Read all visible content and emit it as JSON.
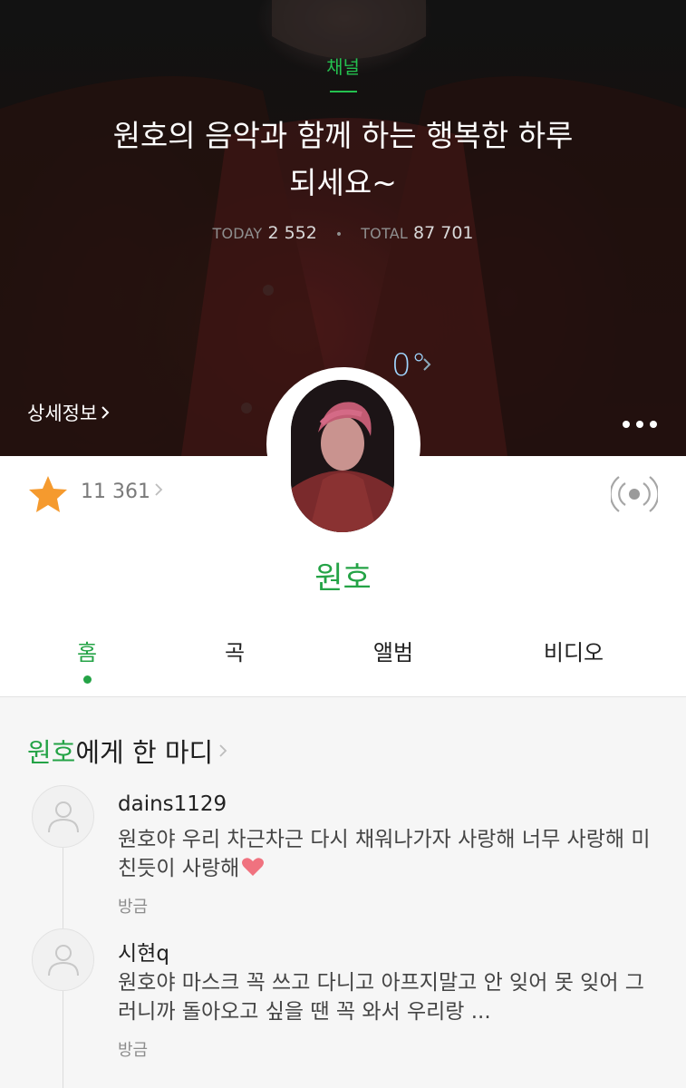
{
  "hero": {
    "channel_label": "채널",
    "title": "원호의 음악과 함께 하는 행복한 하루 되세요~",
    "today_label": "TODAY",
    "today_value": "2 552",
    "total_label": "TOTAL",
    "total_value": "87 701",
    "temperature": "0°",
    "detail_link": "상세정보"
  },
  "profile": {
    "fan_count": "11 361",
    "artist_name": "원호"
  },
  "tabs": [
    {
      "label": "홈",
      "active": true
    },
    {
      "label": "곡",
      "active": false
    },
    {
      "label": "앨범",
      "active": false
    },
    {
      "label": "비디오",
      "active": false
    }
  ],
  "comments_section": {
    "title_highlight": "원호",
    "title_rest": "에게 한 마디",
    "comments": [
      {
        "user": "dains1129",
        "text": "원호야 우리 차근차근 다시 채워나가자 사랑해 너무 사랑해 미친듯이 사랑해",
        "time": "방금"
      },
      {
        "user": "시현q",
        "text": "원호야 마스크 꼭 쓰고 다니고 아프지말고 안 잊어 못 잊어 그러니까 돌아오고 싶을 땐 꼭 와서 우리랑 ...",
        "time": "방금"
      }
    ]
  },
  "colors": {
    "accent_green": "#24a346",
    "channel_green": "#24c14f",
    "star_orange": "#f59a2e",
    "heart_pink": "#f0727f"
  },
  "icons": [
    "chevron-right-icon",
    "more-icon",
    "star-icon",
    "broadcast-icon",
    "user-placeholder-icon",
    "heart-icon"
  ]
}
